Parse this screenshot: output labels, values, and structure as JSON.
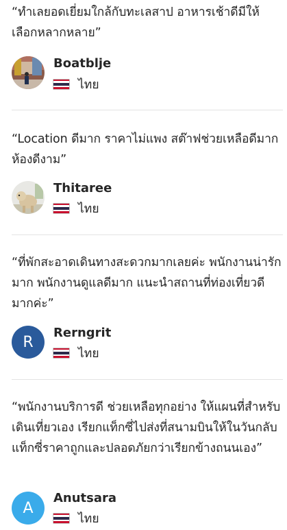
{
  "reviews": [
    {
      "quote": "“ทำเลยอดเยี่ยมใกล้กับทะเลสาป อาหารเช้าดีมีให้เลือกหลากหลาย”",
      "name": "Boatblje",
      "country": "ไทย",
      "avatar": {
        "type": "photo"
      }
    },
    {
      "quote": "“Location ดีมาก ราคาไม่แพง สต๊าฟช่วยเหลือดีมาก ห้องดีงาม”",
      "name": "Thitaree",
      "country": "ไทย",
      "avatar": {
        "type": "photo"
      }
    },
    {
      "quote": "“ที่พักสะอาดเดินทางสะดวกมากเลยค่ะ พนักงานน่ารักมาก พนักงานดูแลดีมาก แนะนำสถานที่ท่องเที่ยวดีมากค่ะ”",
      "name": "Rerngrit",
      "country": "ไทย",
      "avatar": {
        "type": "letter",
        "letter": "R",
        "color": "#2a5a9b"
      }
    },
    {
      "quote": "“พนักงานบริการดี ช่วยเหลือทุกอย่าง ให้แผนที่สำหรับเดินเที่ยวเอง เรียกแท็กซี่ไปส่งที่สนามบินให้ในวันกลับ แท็กซี่ราคาถูกและปลอดภัยกว่าเรียกข้างถนนเอง”",
      "name": "Anutsara",
      "country": "ไทย",
      "avatar": {
        "type": "letter",
        "letter": "A",
        "color": "#3aabea"
      }
    }
  ],
  "flag": {
    "red": "#c8102e",
    "white": "#ffffff",
    "blue": "#2d2a4a"
  }
}
